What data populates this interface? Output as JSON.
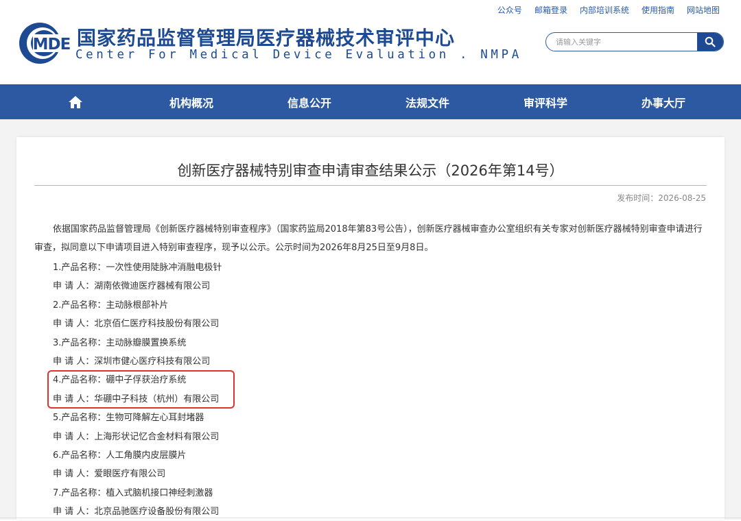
{
  "header": {
    "top_links": [
      "公众号",
      "邮箱登录",
      "内部培训系统",
      "使用指南",
      "网站地图"
    ],
    "logo_abbr": "MDE",
    "title_cn": "国家药品监督管理局医疗器械技术审评中心",
    "title_en": "Center For Medical Device Evaluation . NMPA",
    "search_placeholder": "请输入关键字"
  },
  "nav": {
    "home_icon": "home-icon",
    "items": [
      "机构概况",
      "信息公开",
      "法规文件",
      "审评科学",
      "办事大厅"
    ]
  },
  "article": {
    "title": "创新医疗器械特别审查申请审查结果公示（2026年第14号）",
    "publish_time": "发布时间：2026-08-25",
    "intro": "依据国家药品监督管理局《创新医疗器械特别审查程序》（国家药监局2018年第83号公告），创新医疗器械审查办公室组织有关专家对创新医疗器械特别审查申请进行审查，拟同意以下申请项目进入特别审查程序，现予以公示。公示时间为2026年8月25日至9月8日。",
    "lines": [
      "1.产品名称：一次性使用陡脉冲消融电极针",
      "申 请 人：湖南依微迪医疗器械有限公司",
      "2.产品名称：主动脉根部补片",
      "申 请 人：北京佰仁医疗科技股份有限公司",
      "3.产品名称：主动脉瓣膜置换系统",
      "申 请 人：深圳市健心医疗科技有限公司",
      "4.产品名称：硼中子俘获治疗系统",
      "申 请 人：华硼中子科技（杭州）有限公司",
      "5.产品名称：生物可降解左心耳封堵器",
      "申 请 人：上海形状记忆合金材料有限公司",
      "6.产品名称：人工角膜内皮层膜片",
      "申 请 人：爱眼医疗有限公司",
      "7.产品名称：植入式脑机接口神经刺激器",
      "申 请 人：北京品驰医疗设备股份有限公司"
    ]
  },
  "colors": {
    "brand_blue": "#1d4a92",
    "nav_blue": "#2c59a2",
    "highlight_red": "#e0312a"
  }
}
